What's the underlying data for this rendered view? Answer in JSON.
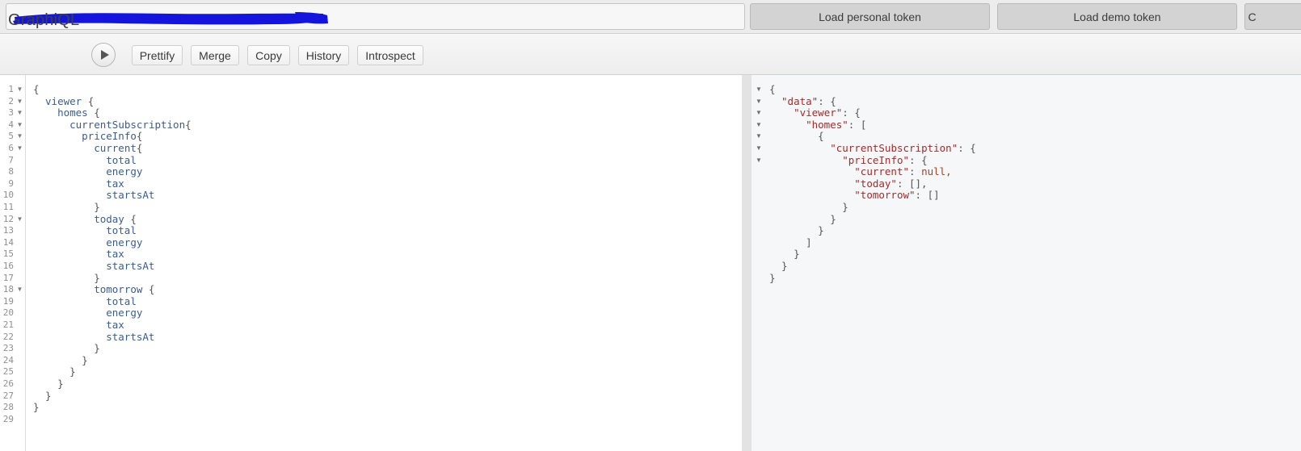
{
  "token_bar": {
    "input": {
      "value": "",
      "placeholder": "",
      "redacted": true,
      "redaction_color": "#1414dc"
    },
    "buttons": [
      {
        "label": "Load personal token"
      },
      {
        "label": "Load demo token"
      },
      {
        "label": "C"
      }
    ]
  },
  "toolbar": {
    "logo": "GraphiQL",
    "execute_label": "▶",
    "buttons": [
      {
        "label": "Prettify"
      },
      {
        "label": "Merge"
      },
      {
        "label": "Copy"
      },
      {
        "label": "History"
      },
      {
        "label": "Introspect"
      }
    ]
  },
  "query_editor": {
    "total_lines": 29,
    "fold_lines": [
      1,
      2,
      3,
      4,
      5,
      6,
      12,
      18
    ],
    "lines": [
      {
        "n": 1,
        "indent": 0,
        "field": "",
        "punct": "{"
      },
      {
        "n": 2,
        "indent": 1,
        "field": "viewer",
        "punct": " {"
      },
      {
        "n": 3,
        "indent": 2,
        "field": "homes",
        "punct": " {"
      },
      {
        "n": 4,
        "indent": 3,
        "field": "currentSubscription",
        "punct": "{"
      },
      {
        "n": 5,
        "indent": 4,
        "field": "priceInfo",
        "punct": "{"
      },
      {
        "n": 6,
        "indent": 5,
        "field": "current",
        "punct": "{"
      },
      {
        "n": 7,
        "indent": 6,
        "field": "total",
        "punct": ""
      },
      {
        "n": 8,
        "indent": 6,
        "field": "energy",
        "punct": ""
      },
      {
        "n": 9,
        "indent": 6,
        "field": "tax",
        "punct": ""
      },
      {
        "n": 10,
        "indent": 6,
        "field": "startsAt",
        "punct": ""
      },
      {
        "n": 11,
        "indent": 5,
        "field": "",
        "punct": "}"
      },
      {
        "n": 12,
        "indent": 5,
        "field": "today",
        "punct": " {"
      },
      {
        "n": 13,
        "indent": 6,
        "field": "total",
        "punct": ""
      },
      {
        "n": 14,
        "indent": 6,
        "field": "energy",
        "punct": ""
      },
      {
        "n": 15,
        "indent": 6,
        "field": "tax",
        "punct": ""
      },
      {
        "n": 16,
        "indent": 6,
        "field": "startsAt",
        "punct": ""
      },
      {
        "n": 17,
        "indent": 5,
        "field": "",
        "punct": "}"
      },
      {
        "n": 18,
        "indent": 5,
        "field": "tomorrow",
        "punct": " {"
      },
      {
        "n": 19,
        "indent": 6,
        "field": "total",
        "punct": ""
      },
      {
        "n": 20,
        "indent": 6,
        "field": "energy",
        "punct": ""
      },
      {
        "n": 21,
        "indent": 6,
        "field": "tax",
        "punct": ""
      },
      {
        "n": 22,
        "indent": 6,
        "field": "startsAt",
        "punct": ""
      },
      {
        "n": 23,
        "indent": 5,
        "field": "",
        "punct": "}"
      },
      {
        "n": 24,
        "indent": 4,
        "field": "",
        "punct": "}"
      },
      {
        "n": 25,
        "indent": 3,
        "field": "",
        "punct": "}"
      },
      {
        "n": 26,
        "indent": 2,
        "field": "",
        "punct": "}"
      },
      {
        "n": 27,
        "indent": 1,
        "field": "",
        "punct": "}"
      },
      {
        "n": 28,
        "indent": 0,
        "field": "",
        "punct": "}"
      },
      {
        "n": 29,
        "indent": 0,
        "field": "",
        "punct": ""
      }
    ]
  },
  "result_viewer": {
    "fold_rows": [
      0,
      1,
      2,
      3,
      4,
      5,
      6
    ],
    "lines": [
      {
        "indent": 0,
        "key": "",
        "value": "{"
      },
      {
        "indent": 1,
        "key": "\"data\"",
        "value": ": {"
      },
      {
        "indent": 2,
        "key": "\"viewer\"",
        "value": ": {"
      },
      {
        "indent": 3,
        "key": "\"homes\"",
        "value": ": ["
      },
      {
        "indent": 4,
        "key": "",
        "value": "{"
      },
      {
        "indent": 5,
        "key": "\"currentSubscription\"",
        "value": ": {"
      },
      {
        "indent": 6,
        "key": "\"priceInfo\"",
        "value": ": {"
      },
      {
        "indent": 7,
        "key": "\"current\"",
        "value": ": ",
        "null_value": "null,"
      },
      {
        "indent": 7,
        "key": "\"today\"",
        "value": ": [],"
      },
      {
        "indent": 7,
        "key": "\"tomorrow\"",
        "value": ": []"
      },
      {
        "indent": 6,
        "key": "",
        "value": "}"
      },
      {
        "indent": 5,
        "key": "",
        "value": "}"
      },
      {
        "indent": 4,
        "key": "",
        "value": "}"
      },
      {
        "indent": 3,
        "key": "",
        "value": "]"
      },
      {
        "indent": 2,
        "key": "",
        "value": "}"
      },
      {
        "indent": 1,
        "key": "",
        "value": "}"
      },
      {
        "indent": 0,
        "key": "",
        "value": "}"
      }
    ]
  }
}
